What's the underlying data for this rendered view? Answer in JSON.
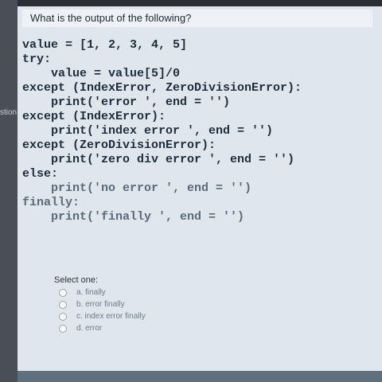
{
  "sidebar": {
    "partial_label": "stion"
  },
  "question": {
    "text": "What is the output of the following?"
  },
  "code": {
    "lines": [
      "value = [1, 2, 3, 4, 5]",
      "try:",
      "    value = value[5]/0",
      "except (IndexError, ZeroDivisionError):",
      "    print('error ', end = '')",
      "except (IndexError):",
      "    print('index error ', end = '')",
      "except (ZeroDivisionError):",
      "    print('zero div error ', end = '')",
      "else:",
      "    print('no error ', end = '')",
      "finally:",
      "    print('finally ', end = '')"
    ]
  },
  "answers": {
    "label": "Select one:",
    "options": [
      "a. finally",
      "b. error finally",
      "c. index error finally",
      "d. error"
    ]
  }
}
